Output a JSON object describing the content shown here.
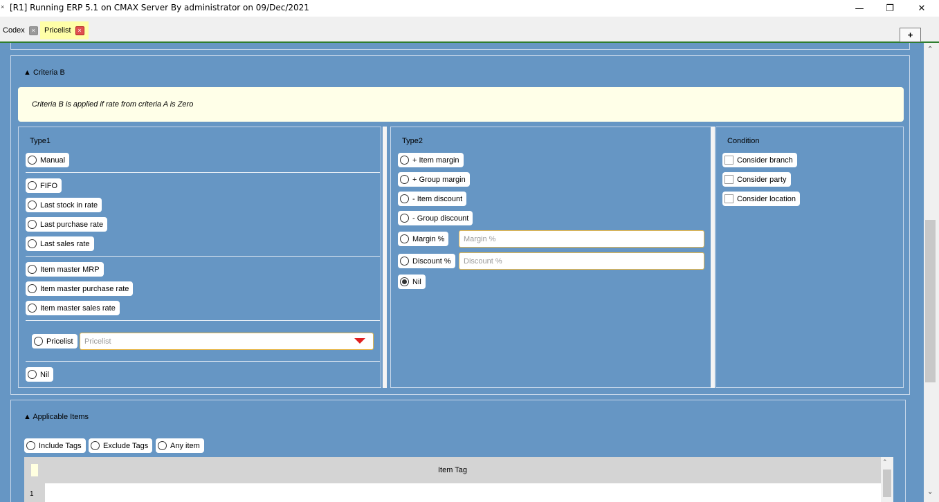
{
  "window": {
    "icon": "×",
    "title": "[R1] Running ERP 5.1 on CMAX Server By administrator on 09/Dec/2021",
    "minimize": "—",
    "maximize": "❐",
    "close": "✕"
  },
  "tabs": [
    {
      "label": "Codex",
      "close": "×"
    },
    {
      "label": "Pricelist",
      "close": "×"
    }
  ],
  "add_tab_label": "+",
  "criteria_b": {
    "header": "▲ Criteria B",
    "info": "Criteria B is applied if rate from criteria A is Zero",
    "type1": {
      "title": "Type1",
      "options": [
        "Manual",
        "FIFO",
        "Last stock in rate",
        "Last purchase rate",
        "Last sales rate",
        "Item master MRP",
        "Item master purchase rate",
        "Item master sales rate",
        "Pricelist",
        "Nil"
      ],
      "pricelist_placeholder": "Pricelist"
    },
    "type2": {
      "title": "Type2",
      "options": [
        "+ Item margin",
        "+ Group margin",
        "- Item discount",
        "- Group discount",
        "Margin %",
        "Discount %",
        "Nil"
      ],
      "margin_placeholder": "Margin %",
      "discount_placeholder": "Discount %",
      "selected": "Nil"
    },
    "condition": {
      "title": "Condition",
      "options": [
        "Consider branch",
        "Consider party",
        "Consider location"
      ]
    }
  },
  "applicable_items": {
    "header": "▲ Applicable Items",
    "options": [
      "Include Tags",
      "Exclude Tags",
      "Any item"
    ],
    "grid": {
      "column": "Item Tag",
      "rows": [
        "1"
      ]
    }
  },
  "scrollbar": {
    "up": "⌃",
    "down": "⌄"
  }
}
